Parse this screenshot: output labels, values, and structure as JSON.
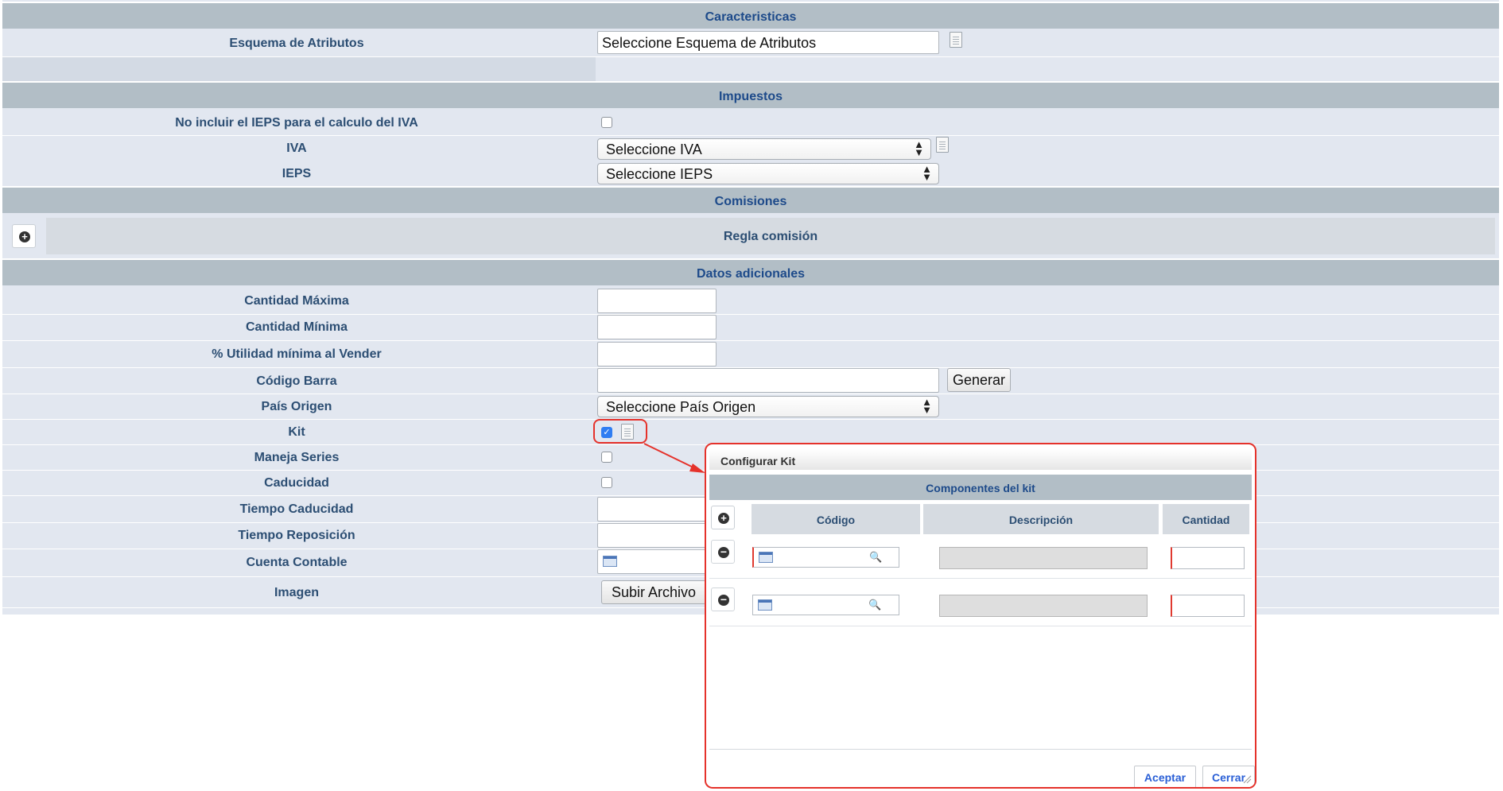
{
  "sections": {
    "caracteristicas": "Caracteristicas",
    "impuestos": "Impuestos",
    "comisiones": "Comisiones",
    "datos_adicionales": "Datos adicionales"
  },
  "caracteristicas": {
    "esquema_label": "Esquema de Atributos",
    "esquema_value": "Seleccione Esquema de Atributos"
  },
  "impuestos": {
    "no_ieps_label": "No incluir el IEPS para el calculo del IVA",
    "iva_label": "IVA",
    "iva_value": "Seleccione IVA",
    "ieps_label": "IEPS",
    "ieps_value": "Seleccione IEPS"
  },
  "comisiones": {
    "regla_label": "Regla comisión"
  },
  "datos": {
    "cantidad_maxima": "Cantidad Máxima",
    "cantidad_minima": "Cantidad Mínima",
    "utilidad_minima": "% Utilidad mínima al Vender",
    "codigo_barra": "Código Barra",
    "generar_button": "Generar",
    "pais_origen": "País Origen",
    "pais_origen_value": "Seleccione País Origen",
    "kit": "Kit",
    "maneja_series": "Maneja Series",
    "caducidad": "Caducidad",
    "tiempo_caducidad": "Tiempo Caducidad",
    "tiempo_reposicion": "Tiempo Reposición",
    "cuenta_contable": "Cuenta Contable",
    "imagen": "Imagen",
    "subir_archivo": "Subir Archivo"
  },
  "dialog": {
    "title": "Configurar Kit",
    "section": "Componentes del kit",
    "columns": {
      "codigo": "Código",
      "descripcion": "Descripción",
      "cantidad": "Cantidad"
    },
    "rows": [
      {
        "codigo": "",
        "descripcion": "",
        "cantidad": ""
      },
      {
        "codigo": "",
        "descripcion": "",
        "cantidad": ""
      }
    ],
    "aceptar": "Aceptar",
    "cerrar": "Cerrar"
  },
  "colors": {
    "section_bg": "#b2bec6",
    "row_bg": "#e2e7f0",
    "label_text": "#2c4e73",
    "highlight": "#e5322b",
    "link_blue": "#2a5fd6"
  }
}
